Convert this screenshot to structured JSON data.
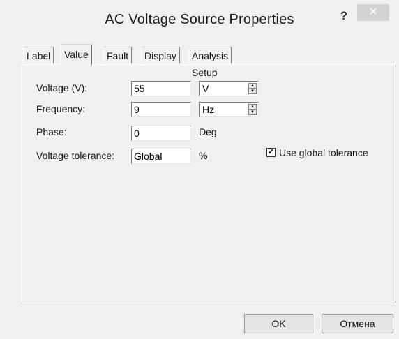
{
  "window": {
    "title": "AC Voltage Source Properties",
    "help_glyph": "?",
    "close_glyph": "✕"
  },
  "tabs": [
    {
      "label": "Label"
    },
    {
      "label": "Value"
    },
    {
      "label": "Fault"
    },
    {
      "label": "Display"
    },
    {
      "label": "Analysis Setup"
    }
  ],
  "active_tab": "Value",
  "form": {
    "voltage": {
      "label": "Voltage (V):",
      "value": "55",
      "unit": "V"
    },
    "frequency": {
      "label": "Frequency:",
      "value": "9",
      "unit": "Hz"
    },
    "phase": {
      "label": "Phase:",
      "value": "0",
      "unit": "Deg"
    },
    "tolerance": {
      "label": "Voltage tolerance:",
      "value": "Global",
      "unit": "%"
    },
    "use_global": {
      "label": "Use global tolerance",
      "checked": true
    }
  },
  "buttons": {
    "ok": "OK",
    "cancel": "Отмена"
  }
}
